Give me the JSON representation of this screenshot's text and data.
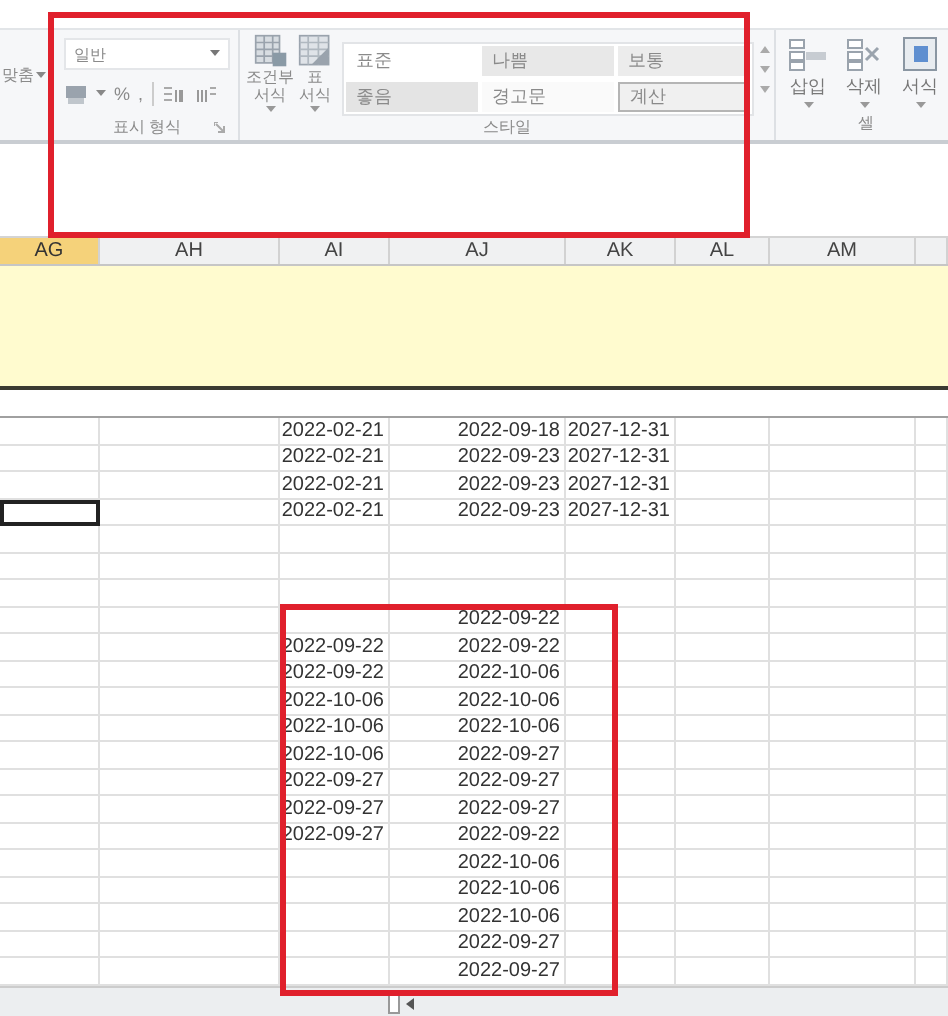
{
  "ribbon": {
    "alignment_group": {
      "label": "맞춤"
    },
    "number_group": {
      "format": "일반",
      "percent": "%",
      "comma": ",",
      "label": "표시 형식"
    },
    "format_buttons": [
      {
        "line1": "조건부",
        "line2": "서식",
        "kind": "conditional"
      },
      {
        "line1": "표",
        "line2": "서식",
        "kind": "table"
      }
    ],
    "styles": {
      "cells": [
        {
          "label": "표준",
          "kind": "normal"
        },
        {
          "label": "나쁨",
          "kind": "bad"
        },
        {
          "label": "보통",
          "kind": "neutral"
        },
        {
          "label": "좋음",
          "kind": "good"
        },
        {
          "label": "경고문",
          "kind": "warning"
        },
        {
          "label": "계산",
          "kind": "calc"
        }
      ],
      "label": "스타일"
    },
    "cells_group": {
      "buttons": [
        {
          "label": "삽입",
          "kind": "insert"
        },
        {
          "label": "삭제",
          "kind": "delete"
        },
        {
          "label": "서식",
          "kind": "format"
        }
      ],
      "label": "셀"
    }
  },
  "columns": [
    {
      "label": "AG",
      "selected": true
    },
    {
      "label": "AH",
      "selected": false
    },
    {
      "label": "AI",
      "selected": false
    },
    {
      "label": "AJ",
      "selected": false
    },
    {
      "label": "AK",
      "selected": false
    },
    {
      "label": "AL",
      "selected": false
    },
    {
      "label": "AM",
      "selected": false
    }
  ],
  "rows": [
    {
      "selected": false,
      "ai": "2022-02-21",
      "aj": "2022-09-18",
      "ak": "2027-12-31"
    },
    {
      "selected": false,
      "ai": "2022-02-21",
      "aj": "2022-09-23",
      "ak": "2027-12-31"
    },
    {
      "selected": false,
      "ai": "2022-02-21",
      "aj": "2022-09-23",
      "ak": "2027-12-31"
    },
    {
      "selected": true,
      "ai": "2022-02-21",
      "aj": "2022-09-23",
      "ak": "2027-12-31"
    },
    {
      "selected": false
    },
    {
      "selected": false
    },
    {
      "selected": false
    },
    {
      "selected": false,
      "aj": "2022-09-22"
    },
    {
      "selected": false,
      "ai": "2022-09-22",
      "aj": "2022-09-22"
    },
    {
      "selected": false,
      "ai": "2022-09-22",
      "aj": "2022-10-06"
    },
    {
      "selected": false,
      "ai": "2022-10-06",
      "aj": "2022-10-06"
    },
    {
      "selected": false,
      "ai": "2022-10-06",
      "aj": "2022-10-06"
    },
    {
      "selected": false,
      "ai": "2022-10-06",
      "aj": "2022-09-27"
    },
    {
      "selected": false,
      "ai": "2022-09-27",
      "aj": "2022-09-27"
    },
    {
      "selected": false,
      "ai": "2022-09-27",
      "aj": "2022-09-27"
    },
    {
      "selected": false,
      "ai": "2022-09-27",
      "aj": "2022-09-22"
    },
    {
      "selected": false,
      "aj": "2022-10-06"
    },
    {
      "selected": false,
      "aj": "2022-10-06"
    },
    {
      "selected": false,
      "aj": "2022-10-06"
    },
    {
      "selected": false,
      "aj": "2022-09-27"
    },
    {
      "selected": false,
      "aj": "2022-09-27"
    }
  ]
}
